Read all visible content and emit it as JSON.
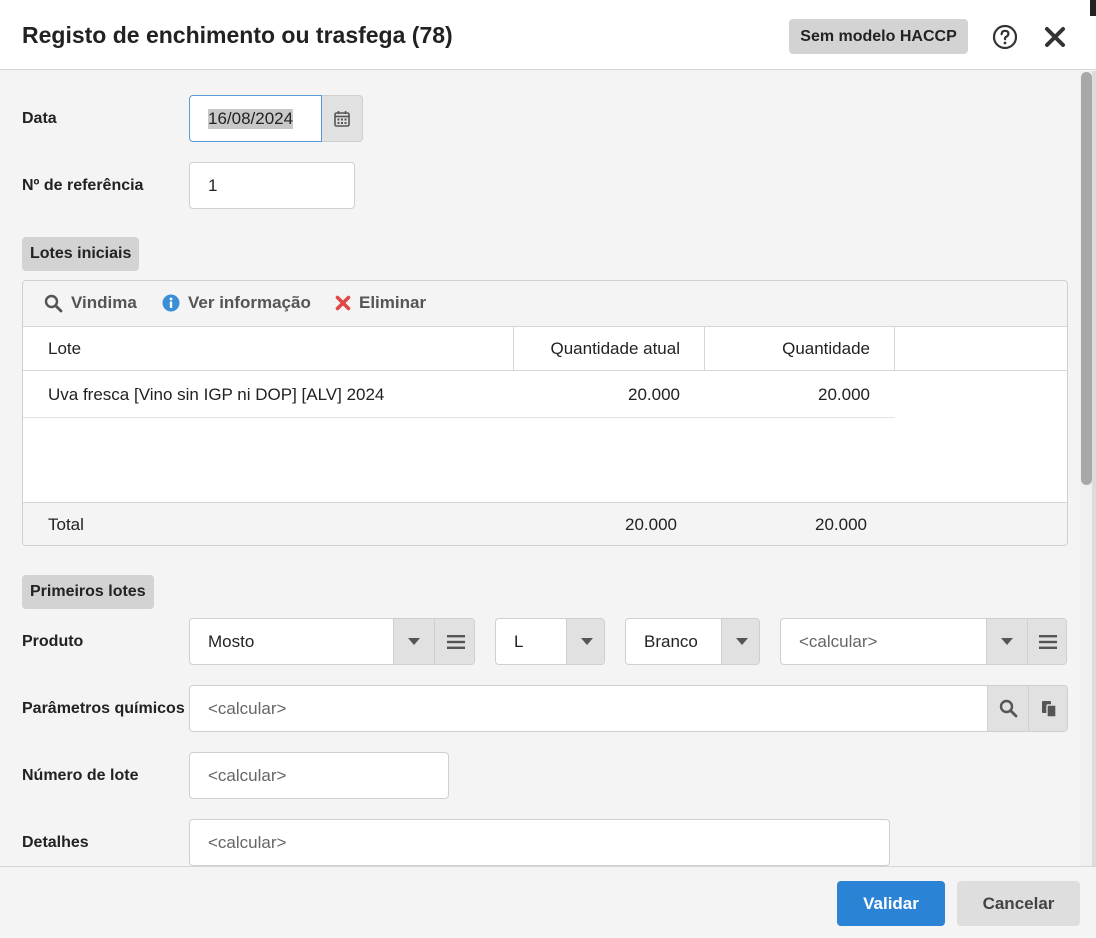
{
  "header": {
    "title": "Registo de enchimento ou trasfega (78)",
    "haccp_label": "Sem modelo HACCP"
  },
  "form": {
    "date_label": "Data",
    "date_value": "16/08/2024",
    "ref_label": "Nº de referência",
    "ref_value": "1"
  },
  "lotes_iniciais": {
    "section_label": "Lotes iniciais",
    "toolbar": {
      "vindima": "Vindima",
      "ver_info": "Ver informação",
      "eliminar": "Eliminar"
    },
    "columns": [
      "Lote",
      "Quantidade atual",
      "Quantidade"
    ],
    "rows": [
      {
        "lote": "Uva fresca [Vino sin IGP ni DOP] [ALV] 2024",
        "qtd_atual": "20.000",
        "qtd": "20.000"
      }
    ],
    "total": {
      "label": "Total",
      "qtd_atual": "20.000",
      "qtd": "20.000"
    }
  },
  "primeiros_lotes": {
    "section_label": "Primeiros lotes",
    "produto_label": "Produto",
    "produto_value": "Mosto",
    "unit_value": "L",
    "color_value": "Branco",
    "extra_placeholder": "<calcular>",
    "parametros_label": "Parâmetros químicos",
    "parametros_placeholder": "<calcular>",
    "numero_lote_label": "Número de lote",
    "numero_lote_placeholder": "<calcular>",
    "detalhes_label": "Detalhes",
    "detalhes_placeholder": "<calcular>"
  },
  "footer": {
    "validar": "Validar",
    "cancelar": "Cancelar"
  },
  "colors": {
    "primary": "#2b83d6",
    "danger": "#e04848",
    "info": "#3a8fd6"
  }
}
